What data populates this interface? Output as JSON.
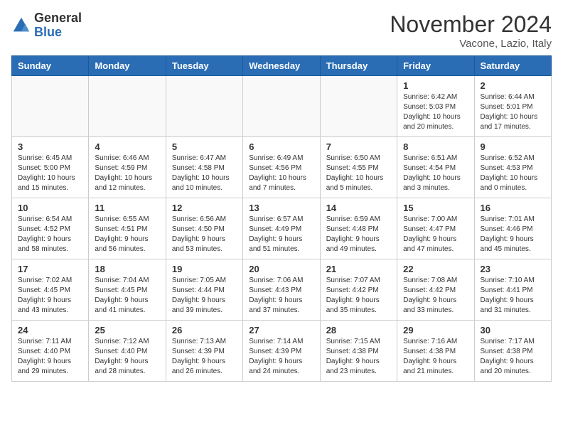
{
  "logo": {
    "line1": "General",
    "line2": "Blue"
  },
  "title": "November 2024",
  "subtitle": "Vacone, Lazio, Italy",
  "weekdays": [
    "Sunday",
    "Monday",
    "Tuesday",
    "Wednesday",
    "Thursday",
    "Friday",
    "Saturday"
  ],
  "weeks": [
    [
      {
        "day": "",
        "info": ""
      },
      {
        "day": "",
        "info": ""
      },
      {
        "day": "",
        "info": ""
      },
      {
        "day": "",
        "info": ""
      },
      {
        "day": "",
        "info": ""
      },
      {
        "day": "1",
        "info": "Sunrise: 6:42 AM\nSunset: 5:03 PM\nDaylight: 10 hours\nand 20 minutes."
      },
      {
        "day": "2",
        "info": "Sunrise: 6:44 AM\nSunset: 5:01 PM\nDaylight: 10 hours\nand 17 minutes."
      }
    ],
    [
      {
        "day": "3",
        "info": "Sunrise: 6:45 AM\nSunset: 5:00 PM\nDaylight: 10 hours\nand 15 minutes."
      },
      {
        "day": "4",
        "info": "Sunrise: 6:46 AM\nSunset: 4:59 PM\nDaylight: 10 hours\nand 12 minutes."
      },
      {
        "day": "5",
        "info": "Sunrise: 6:47 AM\nSunset: 4:58 PM\nDaylight: 10 hours\nand 10 minutes."
      },
      {
        "day": "6",
        "info": "Sunrise: 6:49 AM\nSunset: 4:56 PM\nDaylight: 10 hours\nand 7 minutes."
      },
      {
        "day": "7",
        "info": "Sunrise: 6:50 AM\nSunset: 4:55 PM\nDaylight: 10 hours\nand 5 minutes."
      },
      {
        "day": "8",
        "info": "Sunrise: 6:51 AM\nSunset: 4:54 PM\nDaylight: 10 hours\nand 3 minutes."
      },
      {
        "day": "9",
        "info": "Sunrise: 6:52 AM\nSunset: 4:53 PM\nDaylight: 10 hours\nand 0 minutes."
      }
    ],
    [
      {
        "day": "10",
        "info": "Sunrise: 6:54 AM\nSunset: 4:52 PM\nDaylight: 9 hours\nand 58 minutes."
      },
      {
        "day": "11",
        "info": "Sunrise: 6:55 AM\nSunset: 4:51 PM\nDaylight: 9 hours\nand 56 minutes."
      },
      {
        "day": "12",
        "info": "Sunrise: 6:56 AM\nSunset: 4:50 PM\nDaylight: 9 hours\nand 53 minutes."
      },
      {
        "day": "13",
        "info": "Sunrise: 6:57 AM\nSunset: 4:49 PM\nDaylight: 9 hours\nand 51 minutes."
      },
      {
        "day": "14",
        "info": "Sunrise: 6:59 AM\nSunset: 4:48 PM\nDaylight: 9 hours\nand 49 minutes."
      },
      {
        "day": "15",
        "info": "Sunrise: 7:00 AM\nSunset: 4:47 PM\nDaylight: 9 hours\nand 47 minutes."
      },
      {
        "day": "16",
        "info": "Sunrise: 7:01 AM\nSunset: 4:46 PM\nDaylight: 9 hours\nand 45 minutes."
      }
    ],
    [
      {
        "day": "17",
        "info": "Sunrise: 7:02 AM\nSunset: 4:45 PM\nDaylight: 9 hours\nand 43 minutes."
      },
      {
        "day": "18",
        "info": "Sunrise: 7:04 AM\nSunset: 4:45 PM\nDaylight: 9 hours\nand 41 minutes."
      },
      {
        "day": "19",
        "info": "Sunrise: 7:05 AM\nSunset: 4:44 PM\nDaylight: 9 hours\nand 39 minutes."
      },
      {
        "day": "20",
        "info": "Sunrise: 7:06 AM\nSunset: 4:43 PM\nDaylight: 9 hours\nand 37 minutes."
      },
      {
        "day": "21",
        "info": "Sunrise: 7:07 AM\nSunset: 4:42 PM\nDaylight: 9 hours\nand 35 minutes."
      },
      {
        "day": "22",
        "info": "Sunrise: 7:08 AM\nSunset: 4:42 PM\nDaylight: 9 hours\nand 33 minutes."
      },
      {
        "day": "23",
        "info": "Sunrise: 7:10 AM\nSunset: 4:41 PM\nDaylight: 9 hours\nand 31 minutes."
      }
    ],
    [
      {
        "day": "24",
        "info": "Sunrise: 7:11 AM\nSunset: 4:40 PM\nDaylight: 9 hours\nand 29 minutes."
      },
      {
        "day": "25",
        "info": "Sunrise: 7:12 AM\nSunset: 4:40 PM\nDaylight: 9 hours\nand 28 minutes."
      },
      {
        "day": "26",
        "info": "Sunrise: 7:13 AM\nSunset: 4:39 PM\nDaylight: 9 hours\nand 26 minutes."
      },
      {
        "day": "27",
        "info": "Sunrise: 7:14 AM\nSunset: 4:39 PM\nDaylight: 9 hours\nand 24 minutes."
      },
      {
        "day": "28",
        "info": "Sunrise: 7:15 AM\nSunset: 4:38 PM\nDaylight: 9 hours\nand 23 minutes."
      },
      {
        "day": "29",
        "info": "Sunrise: 7:16 AM\nSunset: 4:38 PM\nDaylight: 9 hours\nand 21 minutes."
      },
      {
        "day": "30",
        "info": "Sunrise: 7:17 AM\nSunset: 4:38 PM\nDaylight: 9 hours\nand 20 minutes."
      }
    ]
  ]
}
